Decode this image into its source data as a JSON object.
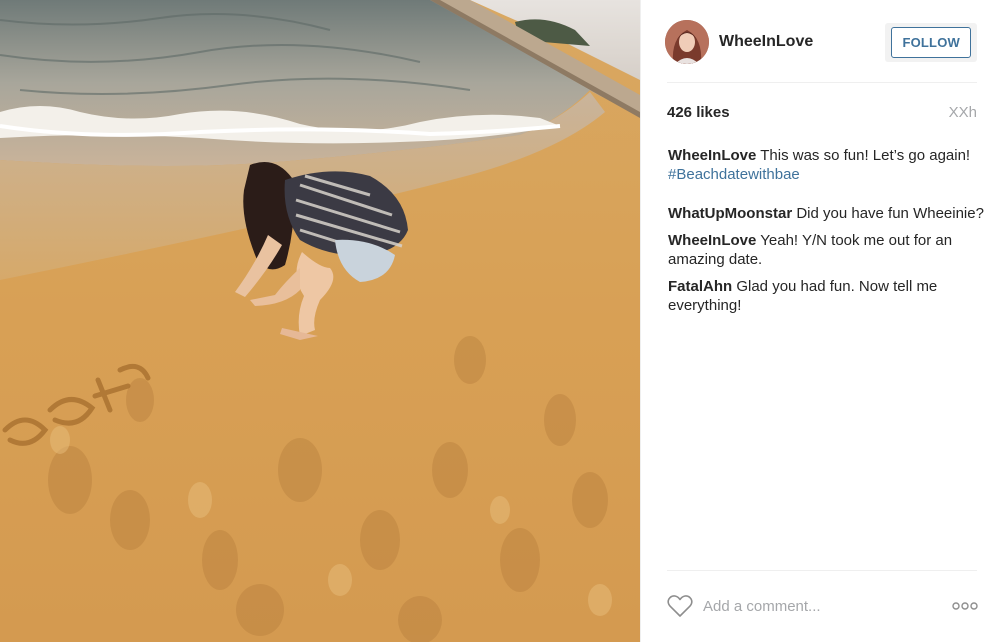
{
  "post": {
    "username": "WheeInLove",
    "follow_label": "FOLLOW",
    "likes": "426 likes",
    "time": "XXh"
  },
  "caption": {
    "author": "WheeInLove",
    "text": " This was so fun! Let’s go again! ",
    "hashtag": "#Beachdatewithbae"
  },
  "comments": [
    {
      "author": "WhatUpMoonstar",
      "text": " Did you have fun Wheeinie?"
    },
    {
      "author": "WheeInLove",
      "text": " Yeah! Y/N took me out for an amazing date."
    },
    {
      "author": "FatalAhn",
      "text": " Glad you had fun. Now tell me everything!"
    }
  ],
  "comment_box": {
    "placeholder": "Add a comment..."
  },
  "icons": {
    "like": "heart-icon",
    "options": "more-options-icon"
  },
  "colors": {
    "link": "#3f729b",
    "muted": "#a5a7aa",
    "text": "#262626"
  }
}
